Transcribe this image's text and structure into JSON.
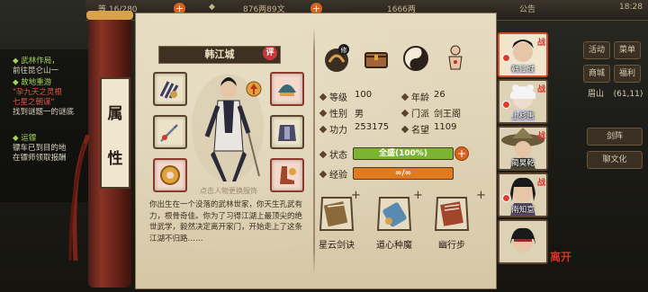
{
  "topbar": {
    "item1": "等  16/280",
    "item2": "876两89文",
    "item3": "1666两",
    "notice": "公告",
    "time": "18:28"
  },
  "quests": [
    {
      "text": "◆ 武林作局，",
      "style": "q-title"
    },
    {
      "text": "前往昆仑山一",
      "style": "q-white"
    },
    {
      "text": "◆ 故地重游",
      "style": "q-title"
    },
    {
      "text": "\"孕九天之灵根",
      "style": "q-red"
    },
    {
      "text": "七星之朝谋\"",
      "style": "q-red"
    },
    {
      "text": "找到谜题一的谜底",
      "style": "q-white"
    },
    {
      "text": "◆ 运镖",
      "style": "q-title"
    },
    {
      "text": "镖车已到目的地",
      "style": "q-white"
    },
    {
      "text": "在镖师领取报酬",
      "style": "q-white"
    }
  ],
  "right_menu": {
    "btn1": "活动",
    "btn2": "菜单",
    "btn3": "商城",
    "btn4": "福利",
    "loc": "眉山",
    "coord": "(61,11)",
    "skill_btn": "剑阵",
    "chat_btn": "聊文化"
  },
  "scroll_label": [
    "属",
    "性"
  ],
  "character": {
    "name": "韩江城",
    "ping": "评",
    "tap_hint": "点击人物更换服饰",
    "bio": "你出生在一个没落的武林世家，你天生孔武有力，根骨奇佳。你为了习得江湖上最顶尖的绝世武学，毅然决定离开家门，开始走上了这条江湖不归路……"
  },
  "stats": {
    "level_label": "等级",
    "level": "100",
    "age_label": "年龄",
    "age": "26",
    "gender_label": "性别",
    "gender": "男",
    "sect_label": "门派",
    "sect": "剑王阁",
    "power_label": "功力",
    "power": "253175",
    "fame_label": "名望",
    "fame": "1109",
    "status_label": "状态",
    "status_text": "全盛(100%)",
    "status_pct": 100,
    "exp_label": "经验",
    "exp_text": "∞/∞",
    "exp_pct": 100
  },
  "skills": [
    {
      "name": "星云剑诀"
    },
    {
      "name": "道心种魔"
    },
    {
      "name": "幽行步"
    }
  ],
  "party": [
    {
      "name": "韩江城",
      "selected": true
    },
    {
      "name": "上杉惠",
      "selected": false
    },
    {
      "name": "蔺昊乾",
      "selected": false
    },
    {
      "name": "南知意",
      "selected": false
    },
    {
      "name": "",
      "selected": false
    }
  ],
  "close_label": "离开",
  "colors": {
    "status_bar": "#7ab431",
    "exp_bar": "#e07a1e",
    "accent_red": "#d93028",
    "paper": "#e6dcc2"
  }
}
